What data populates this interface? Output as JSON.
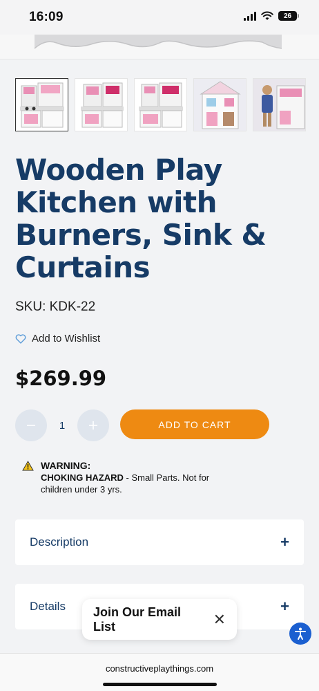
{
  "status_bar": {
    "time": "16:09",
    "battery": "26"
  },
  "product": {
    "title": "Wooden Play Kitchen with Burners, Sink & Curtains",
    "sku": "SKU: KDK-22",
    "wishlist_label": "Add to Wishlist",
    "price": "$269.99",
    "quantity": "1",
    "add_to_cart_label": "ADD TO CART",
    "thumbnails": [
      "kitchen-front-view",
      "kitchen-angle-view",
      "kitchen-side-view",
      "kitchen-playhouse-view",
      "child-with-kitchen"
    ]
  },
  "warning": {
    "title": "WARNING:",
    "hazard": "CHOKING HAZARD",
    "text": " - Small Parts. Not for",
    "text2": "children under 3 yrs."
  },
  "accordions": [
    {
      "label": "Description"
    },
    {
      "label": "Details"
    }
  ],
  "email_popup": {
    "label": "Join Our Email List"
  },
  "browser": {
    "url": "constructiveplaythings.com"
  },
  "colors": {
    "brand_navy": "#163b66",
    "cart_orange": "#ee8a12",
    "qty_button": "#dfe5ed",
    "accessibility_blue": "#1b5fd0"
  }
}
